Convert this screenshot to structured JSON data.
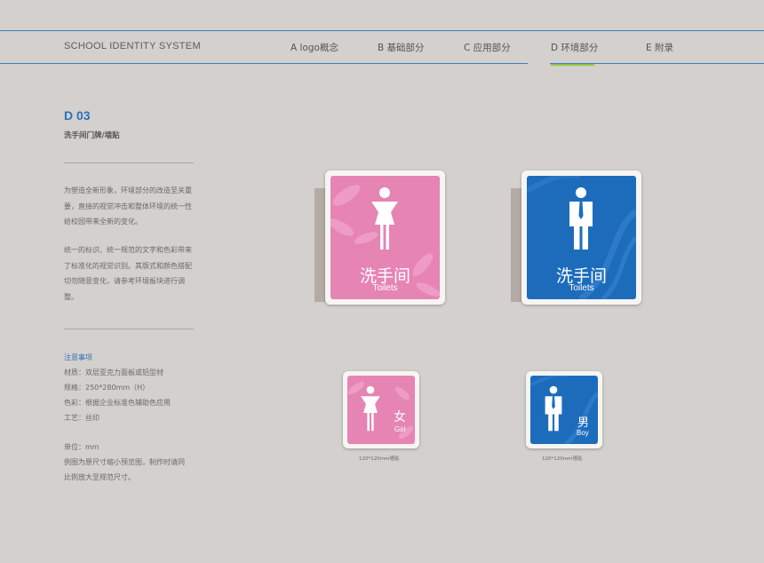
{
  "header": {
    "brand": "SCHOOL IDENTITY SYSTEM",
    "tabs": [
      {
        "label": "A logo概念"
      },
      {
        "label": "B 基础部分"
      },
      {
        "label": "C 应用部分"
      },
      {
        "label": "D 环境部分",
        "active": true
      },
      {
        "label": "E 附录"
      }
    ]
  },
  "section": {
    "code": "D 03",
    "title": "洗手间门牌/墙贴",
    "paragraphs": [
      "为塑造全新形象，环境部分的改造至关重要，直接的视觉冲击和整体环境的统一性给校园带来全新的变化。",
      "统一的标识、统一规范的文字和色彩带来了标准化的视觉识别。其版式和颜色搭配切勿随意变化，请参考环境板块进行调整。"
    ],
    "notes": {
      "title": "注意事项",
      "spec_lines": [
        "材质：双层亚克力面板或铝型材",
        "规格：250*280mm（H）",
        "色彩：根据企业标准色辅助色应用",
        "工艺：丝印"
      ],
      "unit": "单位：mm",
      "remark_lines": [
        "例图为原尺寸缩小预览图，制作时请同",
        "比例放大至规范尺寸。"
      ]
    }
  },
  "signs": {
    "door_women": {
      "zh": "洗手间",
      "en": "Toilets"
    },
    "door_men": {
      "zh": "洗手间",
      "en": "Toilets"
    },
    "wall_women": {
      "zh": "女",
      "en": "Girl",
      "caption": "120*120mm墙贴"
    },
    "wall_men": {
      "zh": "男",
      "en": "Boy",
      "caption": "120*120mm墙贴"
    }
  },
  "colors": {
    "accent_blue": "#2c6fb8",
    "active_tab_underline": "#8fc63f",
    "women_pink": "#e684b4",
    "men_blue": "#1d6cbc",
    "background": "#d3d0cd"
  }
}
